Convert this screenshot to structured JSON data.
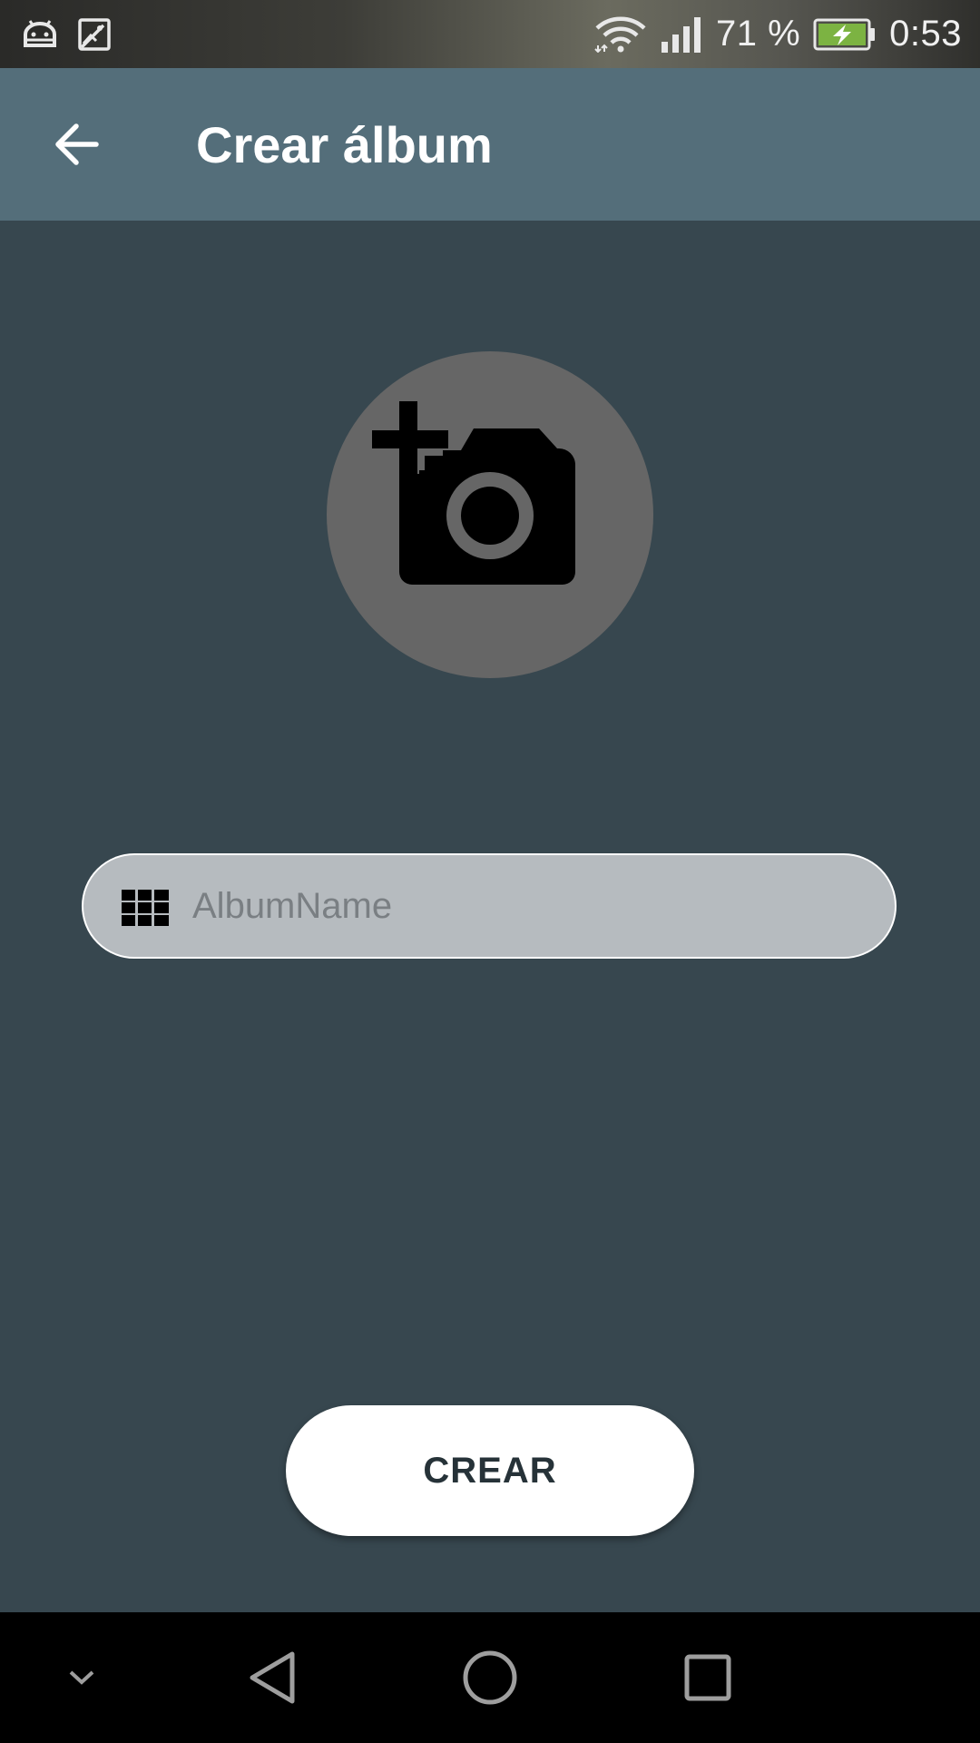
{
  "status_bar": {
    "battery_percent": "71 %",
    "time": "0:53",
    "icons": [
      "android-debug-icon",
      "image-notification-icon",
      "wifi-icon",
      "cell-signal-icon",
      "battery-charging-icon"
    ]
  },
  "app_bar": {
    "title": "Crear álbum",
    "back_icon": "arrow-back-icon"
  },
  "photo_picker": {
    "icon": "add-a-photo-icon"
  },
  "album_name": {
    "placeholder": "AlbumName",
    "value": "",
    "icon": "grid-icon"
  },
  "create_button": {
    "label": "CREAR"
  },
  "nav_bar": {
    "buttons": [
      "collapse-chevron-icon",
      "back-triangle-icon",
      "home-circle-icon",
      "recents-square-icon"
    ]
  },
  "colors": {
    "background": "#37474f",
    "app_bar": "#546e7a",
    "camera_circle": "#666666",
    "input_bg": "#b6bbbf",
    "button_bg": "#ffffff"
  }
}
